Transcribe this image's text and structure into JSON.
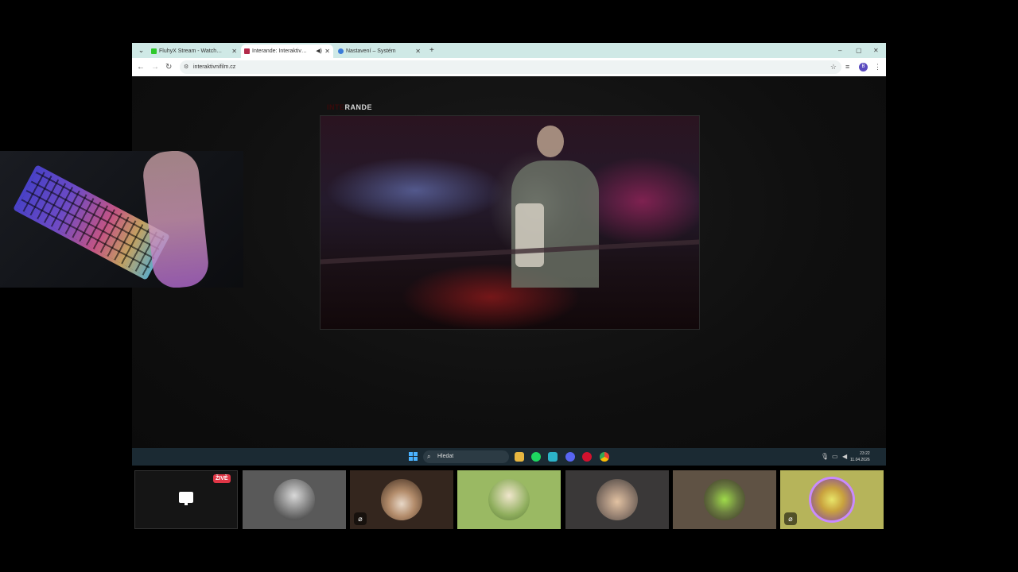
{
  "browser": {
    "tabs": [
      {
        "label": "FluhyX Stream - Watch Live on",
        "favicon_color": "#2fc92c",
        "active": false
      },
      {
        "label": "Interande: Interaktivní film",
        "favicon_color": "#b32a4a",
        "active": true,
        "audio_icon": "speaker-icon"
      },
      {
        "label": "Nastavení – Systém",
        "favicon_color": "#3b7bd8",
        "active": false
      }
    ],
    "new_tab": "+",
    "url": "interaktivnifilm.cz",
    "profile_initial": "B",
    "window_controls": [
      "–",
      "▢",
      "✕"
    ]
  },
  "page": {
    "brand_prefix": "INTE",
    "brand_name": "RANDE"
  },
  "taskbar": {
    "search_placeholder": "Hledat",
    "apps": [
      "file-explorer-icon",
      "spotify-icon",
      "fluent-app-icon",
      "discord-icon",
      "opera-icon",
      "chrome-icon"
    ],
    "time": "23:22",
    "date": "11.04.2026"
  },
  "call": {
    "live_label": "ŽIVĚ",
    "tile_colors": [
      "#1c1c1c",
      "#595959",
      "#34261e",
      "#9ab963",
      "#3a3838",
      "#5f5244",
      "#b6b45a"
    ],
    "muted_tiles": [
      2,
      6
    ]
  }
}
